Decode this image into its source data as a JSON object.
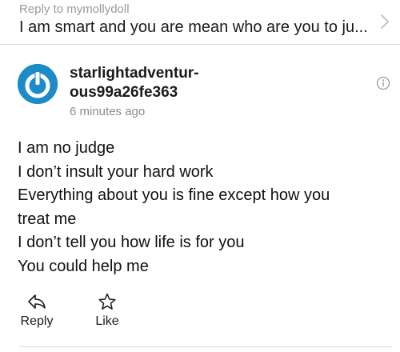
{
  "reply_context": {
    "label": "Reply to mymollydoll",
    "preview": "I am smart and you are mean who are you to ju..."
  },
  "post": {
    "author_line1": "starlightadventur-",
    "author_line2": "ous99a26fe363",
    "timestamp": "6 minutes ago",
    "avatar_color": "#1e8bc9",
    "body_lines": [
      "I am no judge",
      "I don’t insult your hard work",
      "Everything about you is fine except how you",
      "treat me",
      "I don’t tell you how life is for you",
      "You could help me"
    ]
  },
  "actions": {
    "reply_label": "Reply",
    "like_label": "Like"
  },
  "icons": {
    "chevron": "chevron-right-icon",
    "info": "info-icon",
    "reply": "reply-arrow-icon",
    "like": "star-icon"
  }
}
